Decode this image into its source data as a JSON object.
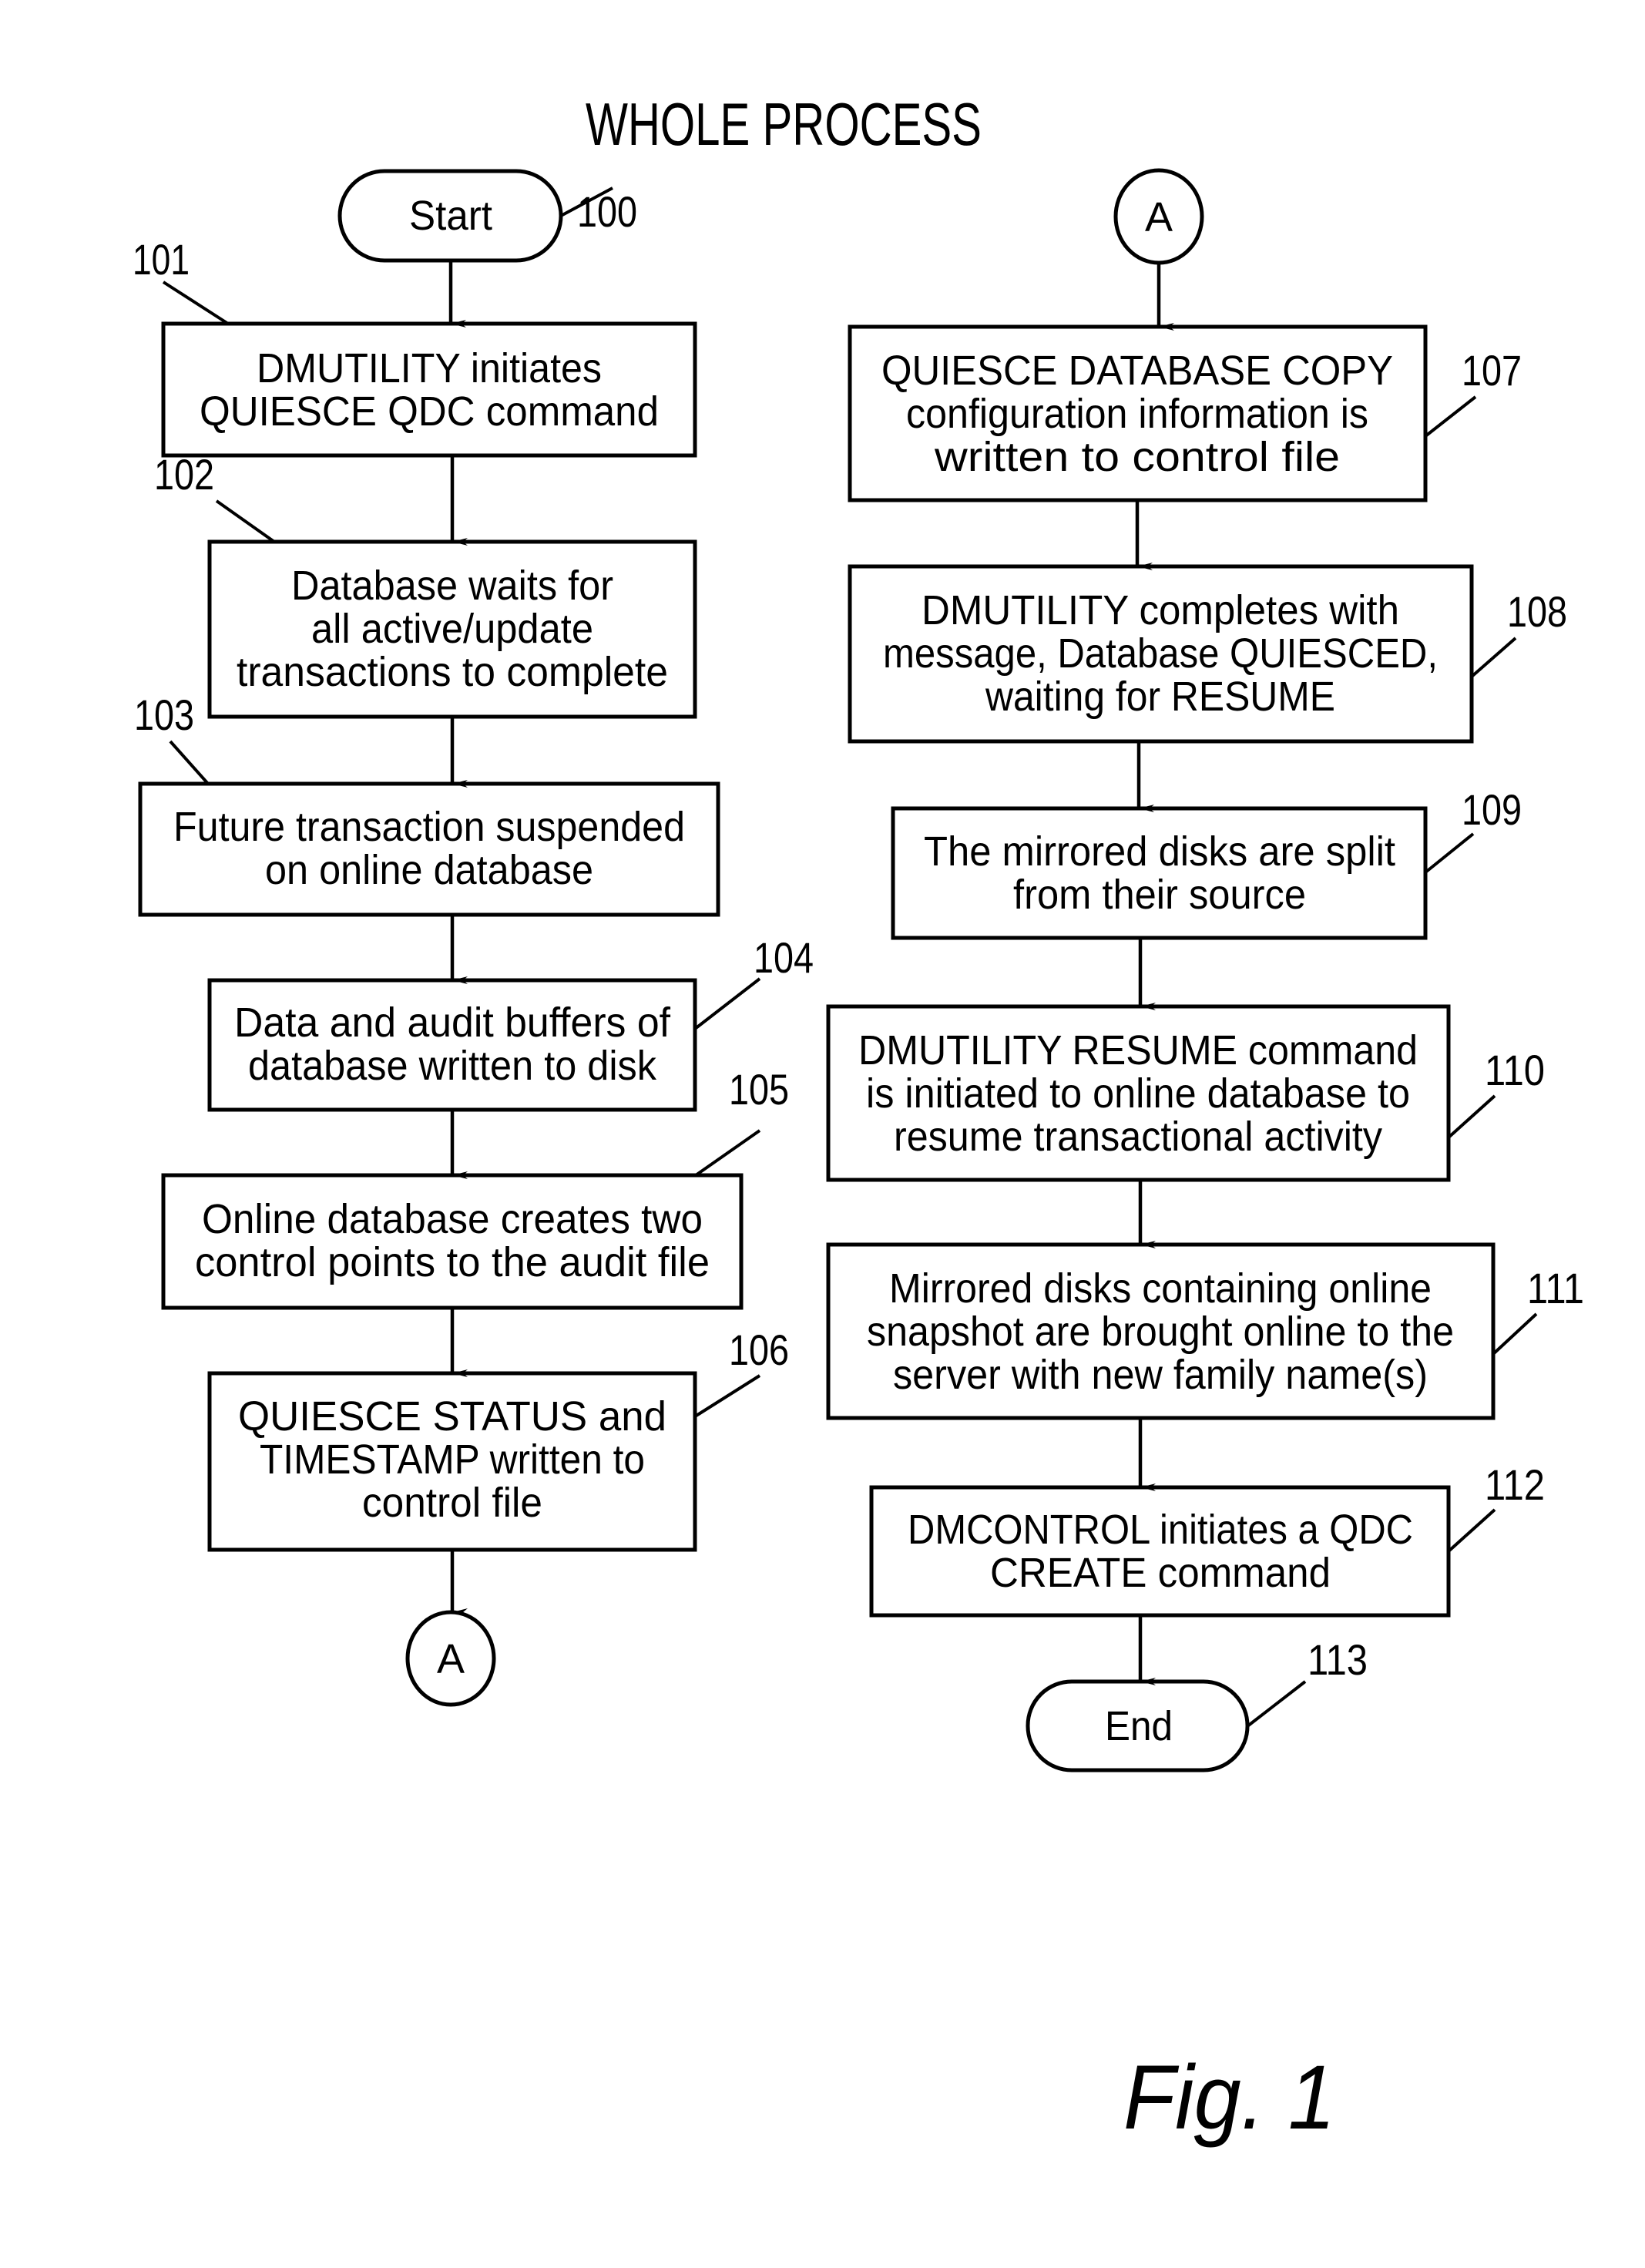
{
  "title": "WHOLE PROCESS",
  "figure_label": "Fig. 1",
  "terminals": {
    "start": {
      "label": "Start",
      "ref": "100"
    },
    "end": {
      "label": "End",
      "ref": "113"
    }
  },
  "connectors": {
    "left_out": "A",
    "right_in": "A"
  },
  "steps": [
    {
      "ref": "101",
      "lines": [
        "DMUTILITY initiates",
        "QUIESCE QDC command"
      ]
    },
    {
      "ref": "102",
      "lines": [
        "Database waits for",
        "all active/update",
        "transactions to complete"
      ]
    },
    {
      "ref": "103",
      "lines": [
        "Future transaction suspended",
        "on online database"
      ]
    },
    {
      "ref": "104",
      "lines": [
        "Data and audit buffers of",
        "database written to disk"
      ]
    },
    {
      "ref": "105",
      "lines": [
        "Online database creates two",
        "control points to the audit file"
      ]
    },
    {
      "ref": "106",
      "lines": [
        "QUIESCE STATUS and",
        "TIMESTAMP written to",
        "control file"
      ]
    },
    {
      "ref": "107",
      "lines": [
        "QUIESCE DATABASE COPY",
        "configuration information is",
        "written to control file"
      ]
    },
    {
      "ref": "108",
      "lines": [
        "DMUTILITY completes with",
        "message, Database QUIESCED,",
        "waiting for RESUME"
      ]
    },
    {
      "ref": "109",
      "lines": [
        "The mirrored disks are split",
        "from their source"
      ]
    },
    {
      "ref": "110",
      "lines": [
        "DMUTILITY RESUME command",
        "is initiated to online database to",
        "resume transactional activity"
      ]
    },
    {
      "ref": "111",
      "lines": [
        "Mirrored disks containing online",
        "snapshot are brought online to the",
        "server with new family name(s)"
      ]
    },
    {
      "ref": "112",
      "lines": [
        "DMCONTROL initiates a QDC",
        "CREATE command"
      ]
    }
  ]
}
